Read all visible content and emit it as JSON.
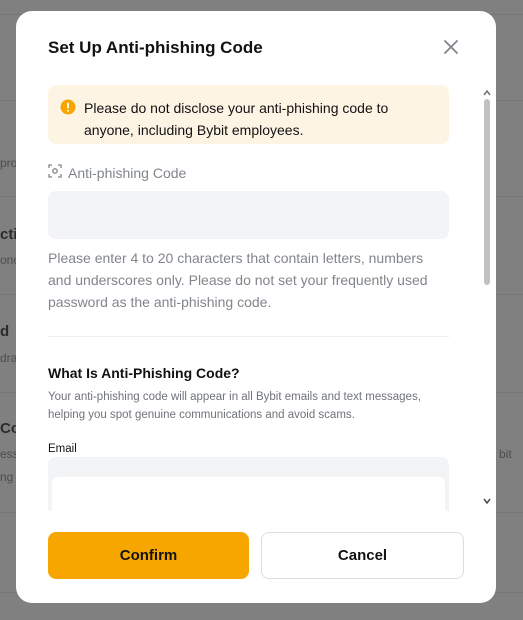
{
  "background": {
    "fragments": [
      "pro",
      "ctio",
      "onc",
      "d",
      "dra",
      "Co",
      "ess",
      "ng",
      "bit"
    ]
  },
  "modal": {
    "title": "Set Up Anti-phishing Code",
    "close_icon": "close-icon",
    "warning": {
      "icon": "exclamation-circle-icon",
      "text": "Please do not disclose your anti-phishing code to anyone, including Bybit employees.",
      "color": "#fdf4e4"
    },
    "code_field": {
      "label": "Anti-phishing Code",
      "icon": "scan-code-icon",
      "value": "",
      "placeholder": ""
    },
    "hint": "Please enter 4 to 20 characters that contain letters, numbers and underscores only. Please do not set your frequently used password as the anti-phishing code.",
    "info": {
      "title": "What Is Anti-Phishing Code?",
      "description": "Your anti-phishing code will appear in all Bybit emails and text messages, helping you spot genuine communications and avoid scams.",
      "email_label": "Email"
    },
    "actions": {
      "confirm_label": "Confirm",
      "cancel_label": "Cancel",
      "accent": "#f7a600"
    }
  }
}
